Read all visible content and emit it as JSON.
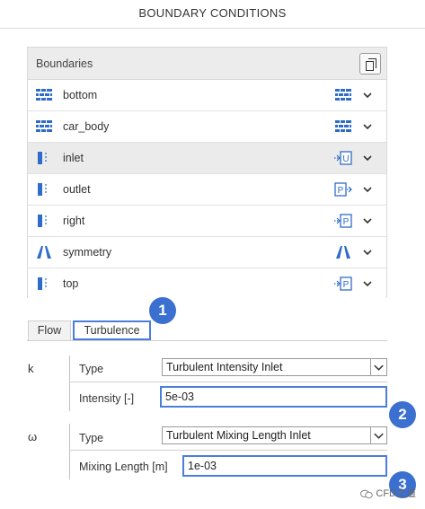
{
  "header": {
    "title": "BOUNDARY CONDITIONS"
  },
  "boundaries": {
    "title": "Boundaries",
    "copy_button_icon": "copy-icon",
    "items": [
      {
        "label": "bottom",
        "type_icon": "wall-icon",
        "condition_icon": "wall-icon",
        "condition_letter": "",
        "selected": false
      },
      {
        "label": "car_body",
        "type_icon": "wall-icon",
        "condition_icon": "wall-icon",
        "condition_letter": "",
        "selected": false
      },
      {
        "label": "inlet",
        "type_icon": "patch-icon",
        "condition_icon": "velocity-inlet-icon",
        "condition_letter": "U",
        "selected": true
      },
      {
        "label": "outlet",
        "type_icon": "patch-icon",
        "condition_icon": "pressure-outlet-icon",
        "condition_letter": "P",
        "selected": false
      },
      {
        "label": "right",
        "type_icon": "patch-icon",
        "condition_icon": "pressure-inlet-icon",
        "condition_letter": "P",
        "selected": false
      },
      {
        "label": "symmetry",
        "type_icon": "symmetry-icon",
        "condition_icon": "symmetry-icon",
        "condition_letter": "",
        "selected": false
      },
      {
        "label": "top",
        "type_icon": "patch-icon",
        "condition_icon": "pressure-inlet-icon",
        "condition_letter": "P",
        "selected": false
      }
    ]
  },
  "tabs": [
    {
      "label": "Flow",
      "active": false
    },
    {
      "label": "Turbulence",
      "active": true
    }
  ],
  "turbulence": {
    "k": {
      "symbol": "k",
      "type_label": "Type",
      "type_value": "Turbulent Intensity Inlet",
      "param_label": "Intensity [-]",
      "param_value": "5e-03"
    },
    "omega": {
      "symbol": "ω",
      "type_label": "Type",
      "type_value": "Turbulent Mixing Length Inlet",
      "param_label": "Mixing Length [m]",
      "param_value": "1e-03"
    }
  },
  "badges": [
    "1",
    "2",
    "3"
  ],
  "watermark": {
    "text": "CFD之道"
  },
  "colors": {
    "accent": "#4a7fd8",
    "badge": "#3b6fd0",
    "icon_blue": "#2f6cc9",
    "selected_row": "#ebebeb"
  }
}
